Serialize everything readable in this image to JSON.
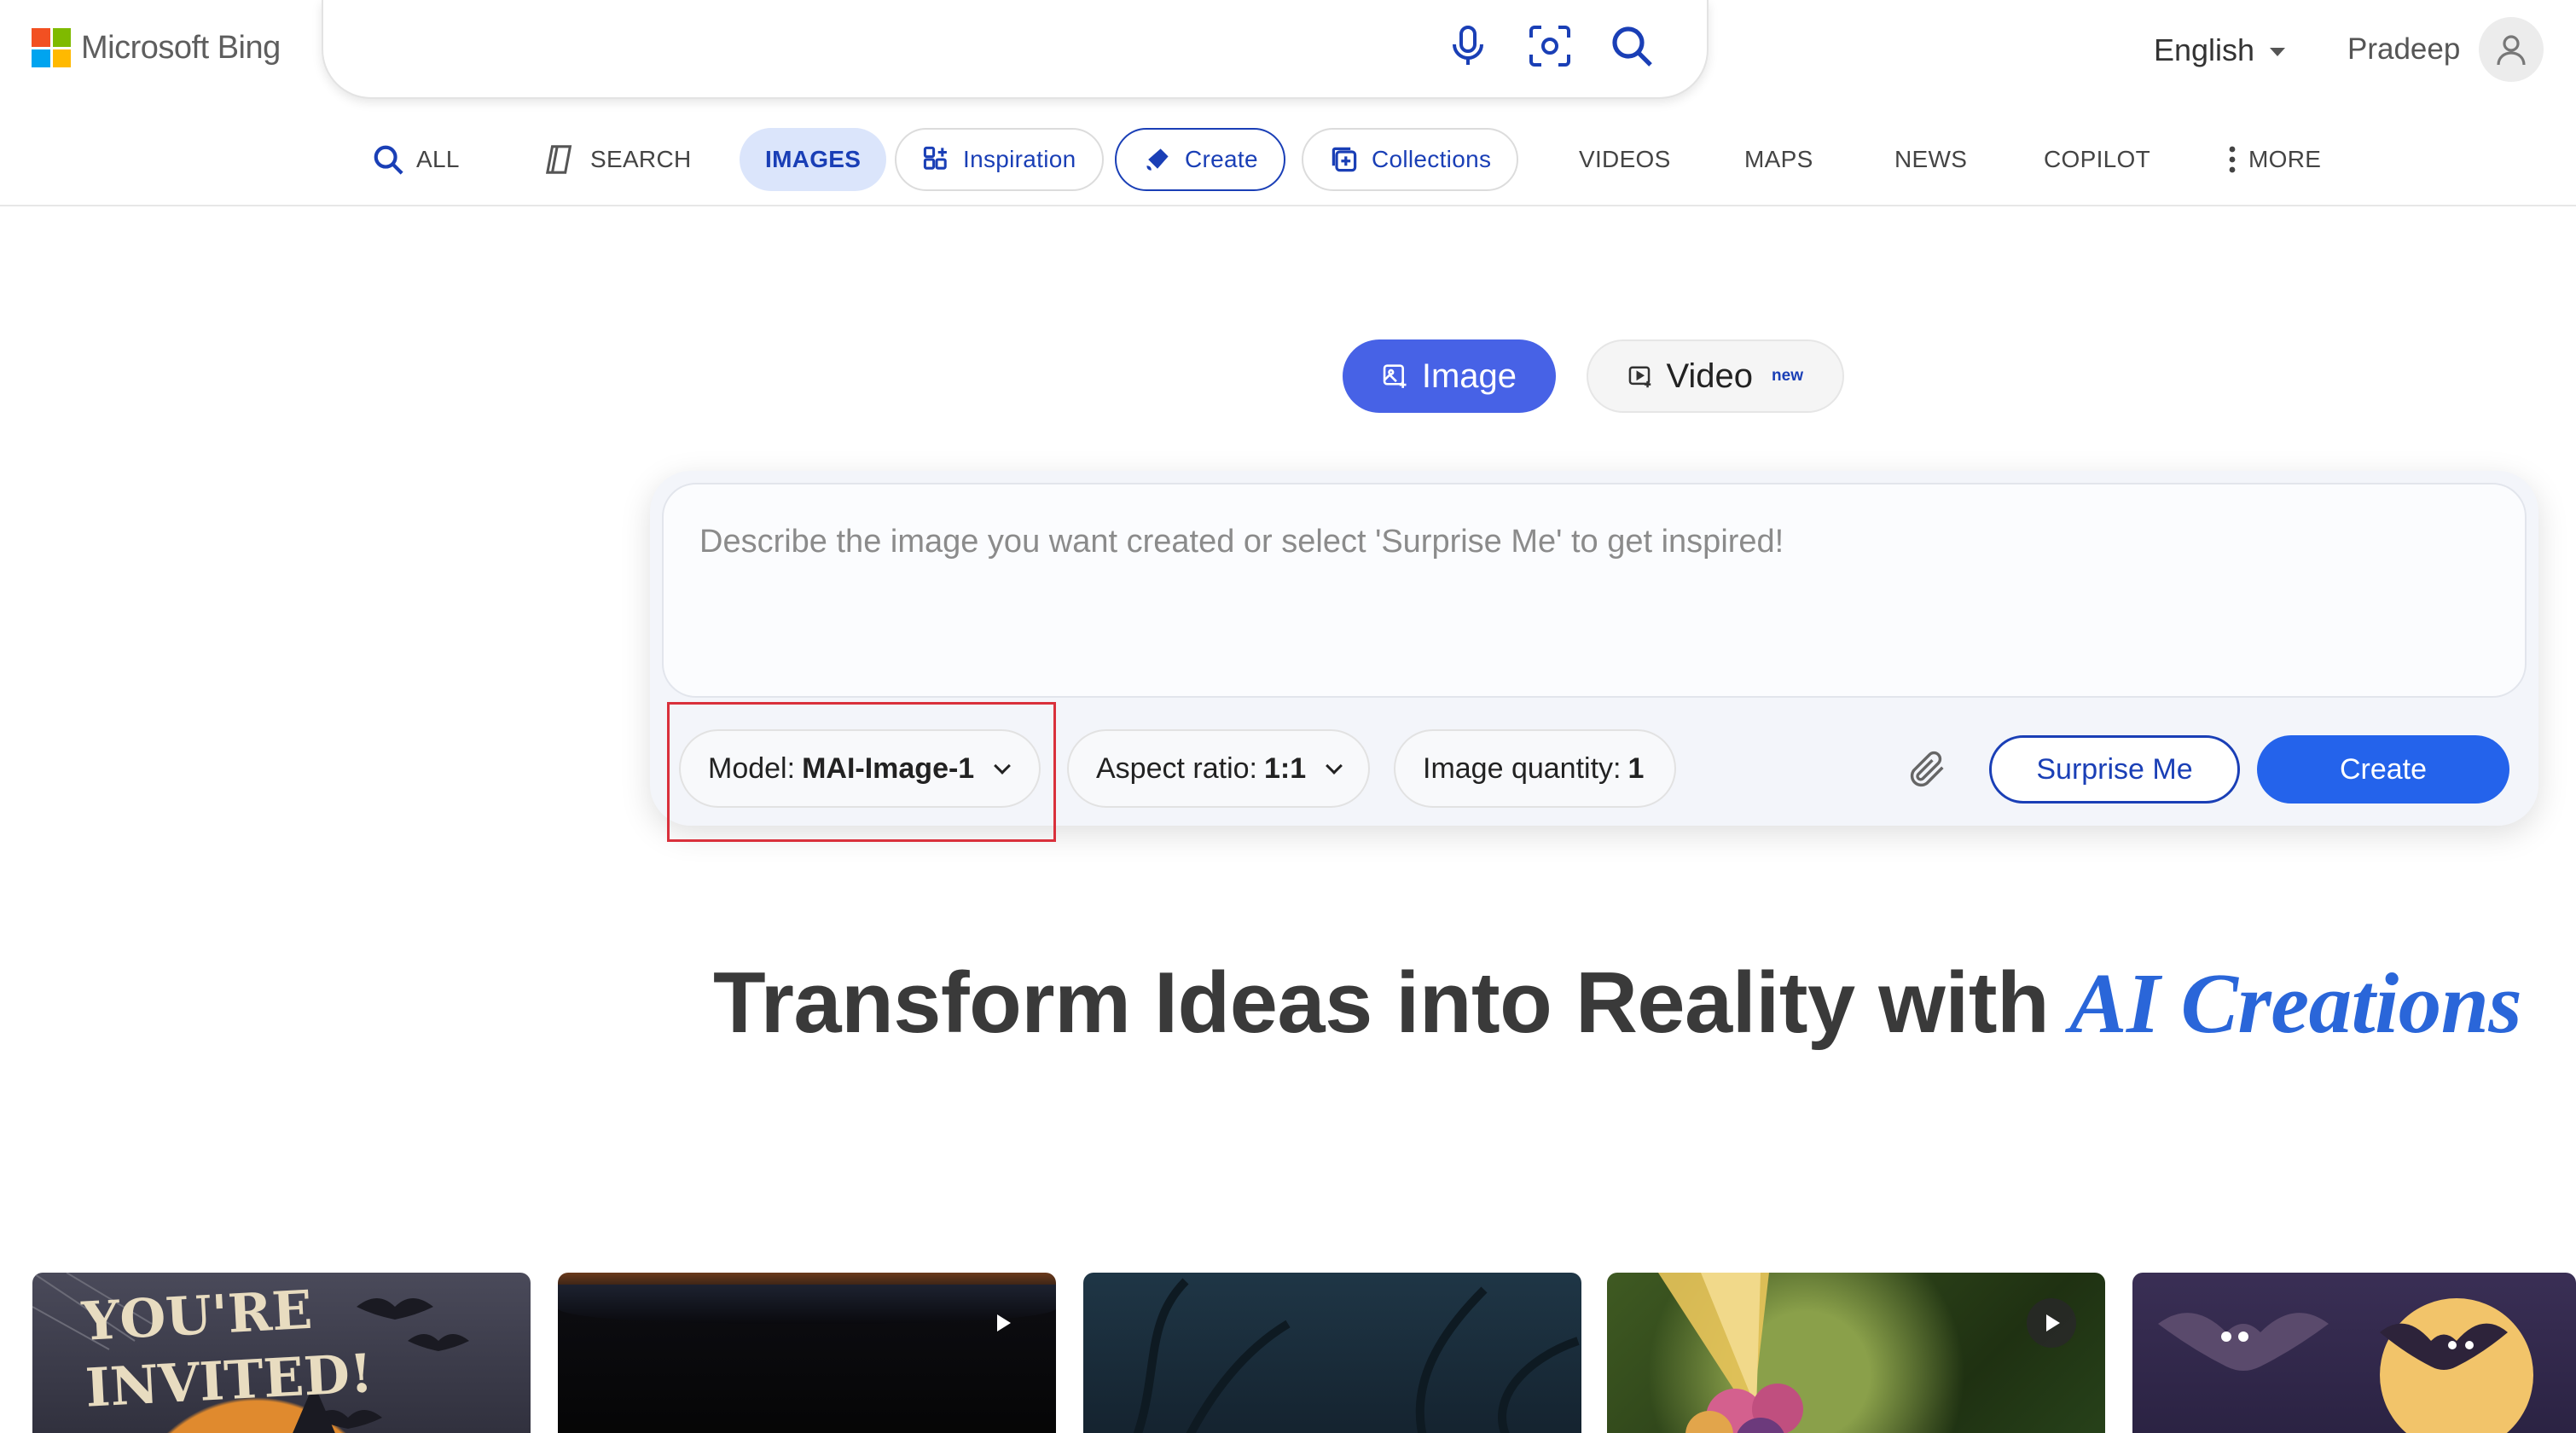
{
  "header": {
    "logo_text": "Microsoft Bing",
    "logo_colors": [
      "#f25022",
      "#7fba00",
      "#00a4ef",
      "#ffb900"
    ],
    "search_value": "",
    "language": "English",
    "user_name": "Pradeep"
  },
  "nav": {
    "items": [
      {
        "label": "ALL",
        "icon": "search-icon"
      },
      {
        "label": "SEARCH",
        "icon": "copilot-search-icon"
      },
      {
        "label": "IMAGES"
      },
      {
        "label": "Inspiration",
        "icon": "inspiration-icon"
      },
      {
        "label": "Create",
        "icon": "create-brush-icon"
      },
      {
        "label": "Collections",
        "icon": "collections-icon"
      },
      {
        "label": "VIDEOS"
      },
      {
        "label": "MAPS"
      },
      {
        "label": "NEWS"
      },
      {
        "label": "COPILOT"
      },
      {
        "label": "MORE",
        "icon": "more-vertical-icon"
      }
    ],
    "active": "IMAGES"
  },
  "mode": {
    "image_label": "Image",
    "video_label": "Video",
    "video_badge": "new",
    "selected": "Image"
  },
  "prompt": {
    "placeholder": "Describe the image you want created or select 'Surprise Me' to get inspired!",
    "value": ""
  },
  "controls": {
    "model_label": "Model:",
    "model_value": "MAI-Image-1",
    "aspect_label": "Aspect ratio:",
    "aspect_value": "1:1",
    "quantity_label": "Image quantity:",
    "quantity_value": "1",
    "surprise_label": "Surprise Me",
    "create_label": "Create"
  },
  "headline": {
    "main": "Transform Ideas into Reality with",
    "accent": "AI Creations"
  },
  "gallery": {
    "tiles": [
      {
        "name": "youre-invited-halloween",
        "text_1": "YOU'RE",
        "text_2": "INVITED!",
        "is_video": false
      },
      {
        "name": "dark-fabric-video",
        "is_video": true
      },
      {
        "name": "dark-forest",
        "is_video": false
      },
      {
        "name": "flower-butterfly-video",
        "is_video": true
      },
      {
        "name": "cartoon-bats-moon",
        "is_video": false
      }
    ]
  },
  "colors": {
    "accent_blue": "#1a3fb6",
    "create_blue": "#2463eb",
    "image_mode_blue": "#4762e6",
    "highlight_red": "#d9303b"
  }
}
